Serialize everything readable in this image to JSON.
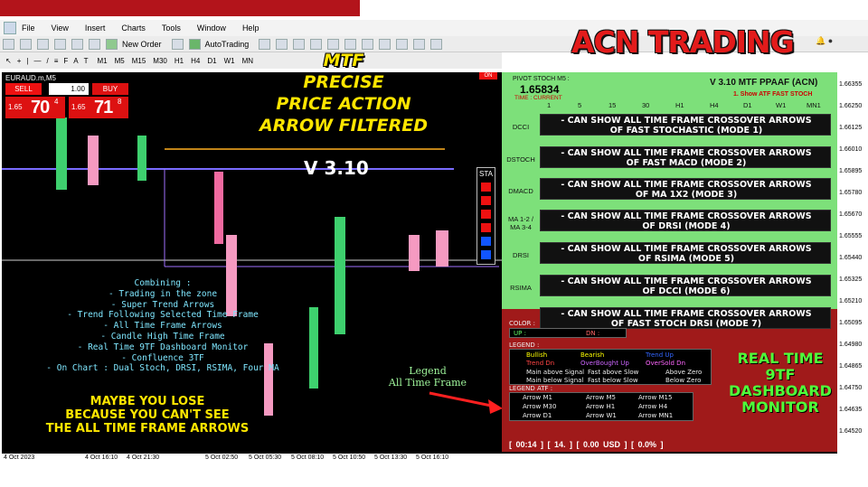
{
  "menu": {
    "items": [
      "File",
      "View",
      "Insert",
      "Charts",
      "Tools",
      "Window",
      "Help"
    ]
  },
  "toolbar": {
    "new_order": "New Order",
    "autotrading": "AutoTrading"
  },
  "timeframes": [
    "M1",
    "M5",
    "M15",
    "M30",
    "H1",
    "H4",
    "D1",
    "W1",
    "MN"
  ],
  "chart": {
    "symbol": "EURAUD.m,M5",
    "sell_label": "SELL",
    "buy_label": "BUY",
    "lot": "1.00",
    "sell_small": "1.65",
    "sell_big": "70",
    "sell_sup": "4",
    "buy_small": "1.65",
    "buy_big": "71",
    "buy_sup": "8",
    "on_badge": "ON",
    "sta_label": "STA"
  },
  "headline": {
    "line1": "MTF",
    "line2": "PRECISE",
    "line3": "PRICE ACTION",
    "line4": "ARROW FILTERED",
    "version": "V 3.10"
  },
  "features": {
    "heading": "Combining :",
    "items": [
      "- Trading in the zone",
      "- Super Trend Arrows",
      "- Trend Following Selected Time Frame",
      "- All Time Frame Arrows",
      "- Candle High Time Frame",
      "- Real Time 9TF Dashboard Monitor",
      "- Confluence 3TF",
      "- On Chart : Dual Stoch, DRSI, RSIMA, Four MA"
    ]
  },
  "warning": {
    "line1": "MAYBE YOU LOSE",
    "line2": "BECAUSE YOU CAN'T SEE",
    "line3": "THE ALL TIME FRAME ARROWS"
  },
  "legend_label": {
    "line1": "Legend",
    "line2": "All Time Frame"
  },
  "brand": "ACN TRADING",
  "dashboard": {
    "pivot_label": "PIVOT STOCH M5 :",
    "pivot_value": "1.65834",
    "time_label": "TIME : CURRENT",
    "title": "V 3.10 MTF PPAAF (ACN)",
    "subtitle": "1. Show ATF FAST STOCH",
    "columns": [
      "1",
      "5",
      "15",
      "30",
      "H1",
      "H4",
      "D1",
      "W1",
      "MN1"
    ],
    "rows": [
      {
        "label": "DCCI",
        "mode_line1": "- CAN SHOW ALL TIME FRAME CROSSOVER ARROWS",
        "mode_line2": "OF FAST STOCHASTIC (MODE 1)"
      },
      {
        "label": "DSTOCH",
        "mode_line1": "- CAN SHOW ALL TIME FRAME CROSSOVER ARROWS",
        "mode_line2": "OF FAST MACD (MODE 2)"
      },
      {
        "label": "DMACD",
        "mode_line1": "- CAN SHOW ALL TIME FRAME CROSSOVER ARROWS",
        "mode_line2": "OF MA 1X2 (MODE 3)"
      },
      {
        "label": "MA 1-2 / MA 3-4",
        "mode_line1": "- CAN SHOW ALL TIME FRAME CROSSOVER ARROWS",
        "mode_line2": "OF DRSI (MODE 4)"
      },
      {
        "label": "DRSI",
        "mode_line1": "- CAN SHOW ALL TIME FRAME CROSSOVER ARROWS",
        "mode_line2": "OF RSIMA (MODE 5)"
      },
      {
        "label": "RSIMA",
        "mode_line1": "- CAN SHOW ALL TIME FRAME CROSSOVER ARROWS",
        "mode_line2": "OF DCCI (MODE 6)"
      }
    ],
    "mode7_line1": "- CAN SHOW ALL TIME FRAME CROSSOVER ARROWS",
    "mode7_line2": "OF FAST STOCH DRSI (MODE 7)"
  },
  "legend_panel": {
    "color_label": "COLOR :",
    "up": "UP :",
    "dn": "DN :",
    "legend_label": "LEGEND :",
    "bullish": "Bullish",
    "bearish": "Bearish",
    "trend_up": "Trend Up",
    "trend_dn": "Trend Dn",
    "overbought": "OverBought Up",
    "oversold": "OverSold Dn",
    "main_above": "Main above Signal",
    "fast_above": "Fast above Slow",
    "above_zero": "Above Zero",
    "main_below": "Main below Signal",
    "fast_below": "Fast below Slow",
    "below_zero": "Below Zero",
    "atf_label": "LEGEND ATF :",
    "arrows": [
      "Arrow M1",
      "Arrow M5",
      "Arrow M15",
      "Arrow M30",
      "Arrow H1",
      "Arrow H4",
      "Arrow D1",
      "Arrow W1",
      "Arrow MN1"
    ]
  },
  "realtime": {
    "line1": "REAL TIME",
    "line2": "9TF",
    "line3": "DASHBOARD",
    "line4": "MONITOR"
  },
  "status": "[ 00:14 ]   [ 14. ]   [ 0.00 USD ]   [ 0.0% ]",
  "price_axis": [
    "1.66355",
    "1.66250",
    "1.66125",
    "1.66010",
    "1.65895",
    "1.65780",
    "1.65670",
    "1.65555",
    "1.65440",
    "1.65325",
    "1.65210",
    "1.65095",
    "1.64980",
    "1.64865",
    "1.64750",
    "1.64635",
    "1.64520"
  ],
  "time_axis": [
    "4 Oct 2023",
    "4 Oct 16:10",
    "4 Oct 21:30",
    "5 Oct 02:50",
    "5 Oct 05:30",
    "5 Oct 08:10",
    "5 Oct 10:50",
    "5 Oct 13:30",
    "5 Oct 16:10"
  ],
  "colors": {
    "accent_red": "#b3141b",
    "dashboard_green": "#7de07a",
    "panel_red": "#a01a1a",
    "headline_yellow": "#ffe600"
  }
}
